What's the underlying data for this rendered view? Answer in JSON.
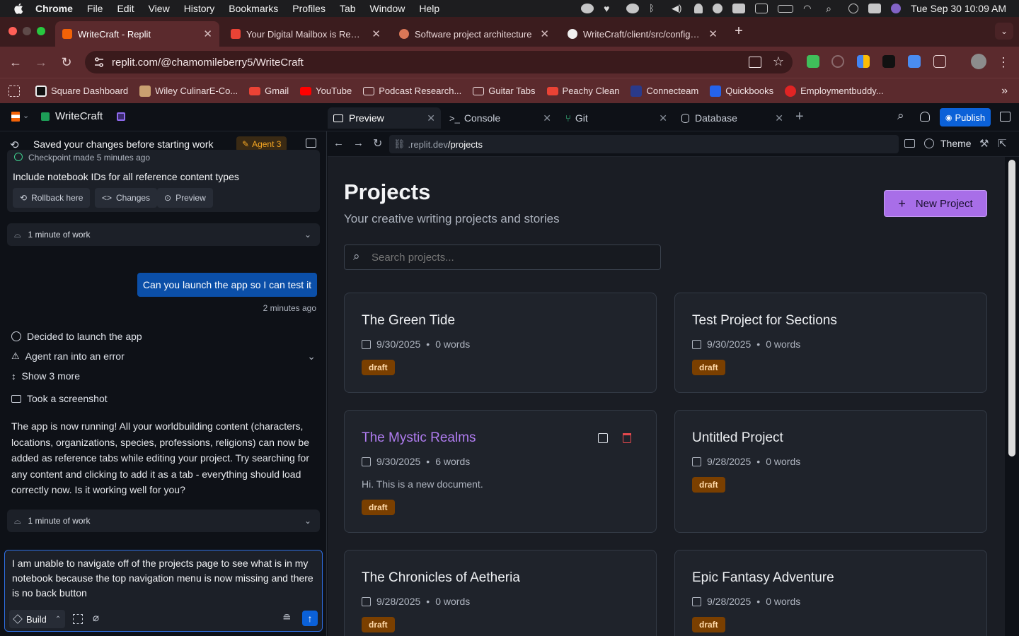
{
  "menubar": {
    "app": "Chrome",
    "items": [
      "File",
      "Edit",
      "View",
      "History",
      "Bookmarks",
      "Profiles",
      "Tab",
      "Window",
      "Help"
    ],
    "clock": "Tue Sep 30  10:09 AM"
  },
  "chrome_tabs": [
    {
      "title": "WriteCraft - Replit"
    },
    {
      "title": "Your Digital Mailbox is Ready!"
    },
    {
      "title": "Software project architecture"
    },
    {
      "title": "WriteCraft/client/src/configs/c"
    }
  ],
  "omnibox": {
    "url": "replit.com/@chamomileberry5/WriteCraft"
  },
  "bookmarks": [
    "Square Dashboard",
    "Wiley CulinarE-Co...",
    "Gmail",
    "YouTube",
    "Podcast Research...",
    "Guitar Tabs",
    "Peachy Clean",
    "Connecteam",
    "Quickbooks",
    "Employmentbuddy..."
  ],
  "replit": {
    "project_name": "WriteCraft",
    "tabs": [
      {
        "label": "Preview"
      },
      {
        "label": "Console"
      },
      {
        "label": "Git"
      },
      {
        "label": "Database"
      }
    ],
    "publish_label": "Publish"
  },
  "chat": {
    "header_title": "Saved your changes before starting work",
    "agent_badge": "Agent 3",
    "checkpoint_time": "Checkpoint made 5 minutes ago",
    "checkpoint_title": "Include notebook IDs for all reference content types",
    "rollback_label": "Rollback here",
    "changes_label": "Changes",
    "preview_label": "Preview",
    "work_summary_1": "1 minute of work",
    "user_message": "Can you launch the app so I can test it",
    "user_message_time": "2 minutes ago",
    "event_1": "Decided to launch the app",
    "event_2": "Agent ran into an error",
    "event_3": "Show 3 more",
    "event_4": "Took a screenshot",
    "agent_reply": "The app is now running! All your worldbuilding content (characters, locations, organizations, species, professions, religions) can now be added as reference tabs while editing your project. Try searching for any content and clicking to add it as a tab - everything should load correctly now. Is it working well for you?",
    "work_summary_2": "1 minute of work",
    "input_value": "I am unable to navigate off of the projects page to see what is in my notebook because the top navigation menu is now missing and there is no back button",
    "mode_label": "Build"
  },
  "preview": {
    "url_prefix": ".replit.dev",
    "url_path": "/projects",
    "theme_label": "Theme",
    "page_title": "Projects",
    "page_subtitle": "Your creative writing projects and stories",
    "new_project_label": "New Project",
    "search_placeholder": "Search projects...",
    "projects": [
      {
        "title": "The Green Tide",
        "date": "9/30/2025",
        "words": "0 words",
        "status": "draft",
        "excerpt": ""
      },
      {
        "title": "Test Project for Sections",
        "date": "9/30/2025",
        "words": "0 words",
        "status": "draft",
        "excerpt": ""
      },
      {
        "title": "The Mystic Realms",
        "date": "9/30/2025",
        "words": "6 words",
        "status": "draft",
        "excerpt": "Hi. This is a new document."
      },
      {
        "title": "Untitled Project",
        "date": "9/28/2025",
        "words": "0 words",
        "status": "draft",
        "excerpt": ""
      },
      {
        "title": "The Chronicles of Aetheria",
        "date": "9/28/2025",
        "words": "0 words",
        "status": "draft",
        "excerpt": ""
      },
      {
        "title": "Epic Fantasy Adventure",
        "date": "9/28/2025",
        "words": "0 words",
        "status": "draft",
        "excerpt": ""
      }
    ],
    "meta_separator": "•"
  },
  "colors": {
    "accent_purple": "#b07cf0",
    "delete_red": "#e5484d",
    "draft_badge": "#7a3f00",
    "publish_blue": "#0b61d8",
    "chrome_frame": "#5b2a2d"
  }
}
